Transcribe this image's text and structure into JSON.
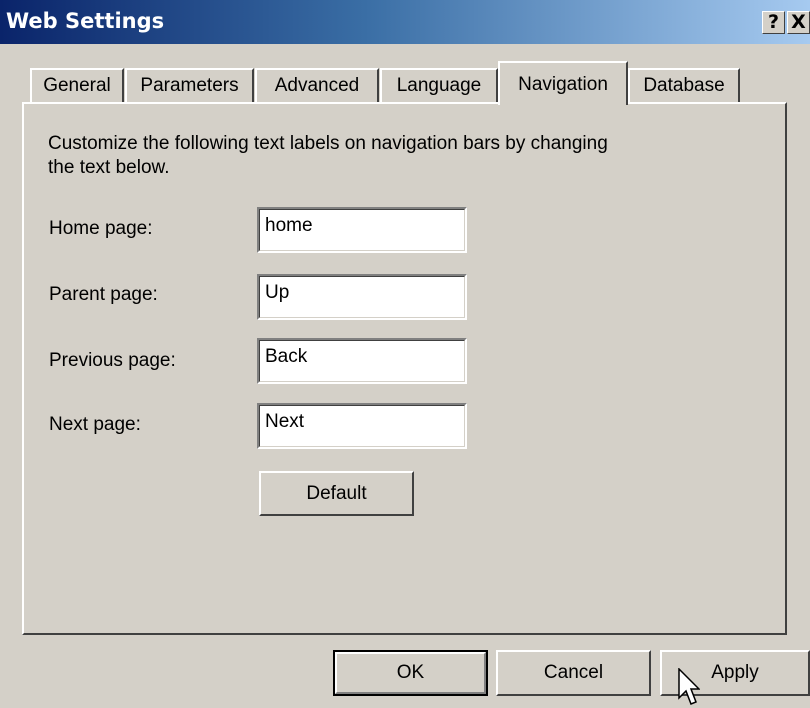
{
  "window": {
    "title": "Web Settings",
    "help_label": "?",
    "close_label": "X"
  },
  "tabs": [
    {
      "label": "General",
      "active": false
    },
    {
      "label": "Parameters",
      "active": false
    },
    {
      "label": "Advanced",
      "active": false
    },
    {
      "label": "Language",
      "active": false
    },
    {
      "label": "Navigation",
      "active": true
    },
    {
      "label": "Database",
      "active": false
    }
  ],
  "navigation": {
    "description": "Customize the following text labels on navigation bars by changing the text below.",
    "fields": [
      {
        "label": "Home page:",
        "value": "home"
      },
      {
        "label": "Parent page:",
        "value": "Up"
      },
      {
        "label": "Previous page:",
        "value": "Back"
      },
      {
        "label": "Next page:",
        "value": "Next"
      }
    ],
    "default_button": "Default"
  },
  "footer": {
    "ok": "OK",
    "cancel": "Cancel",
    "apply": "Apply"
  }
}
